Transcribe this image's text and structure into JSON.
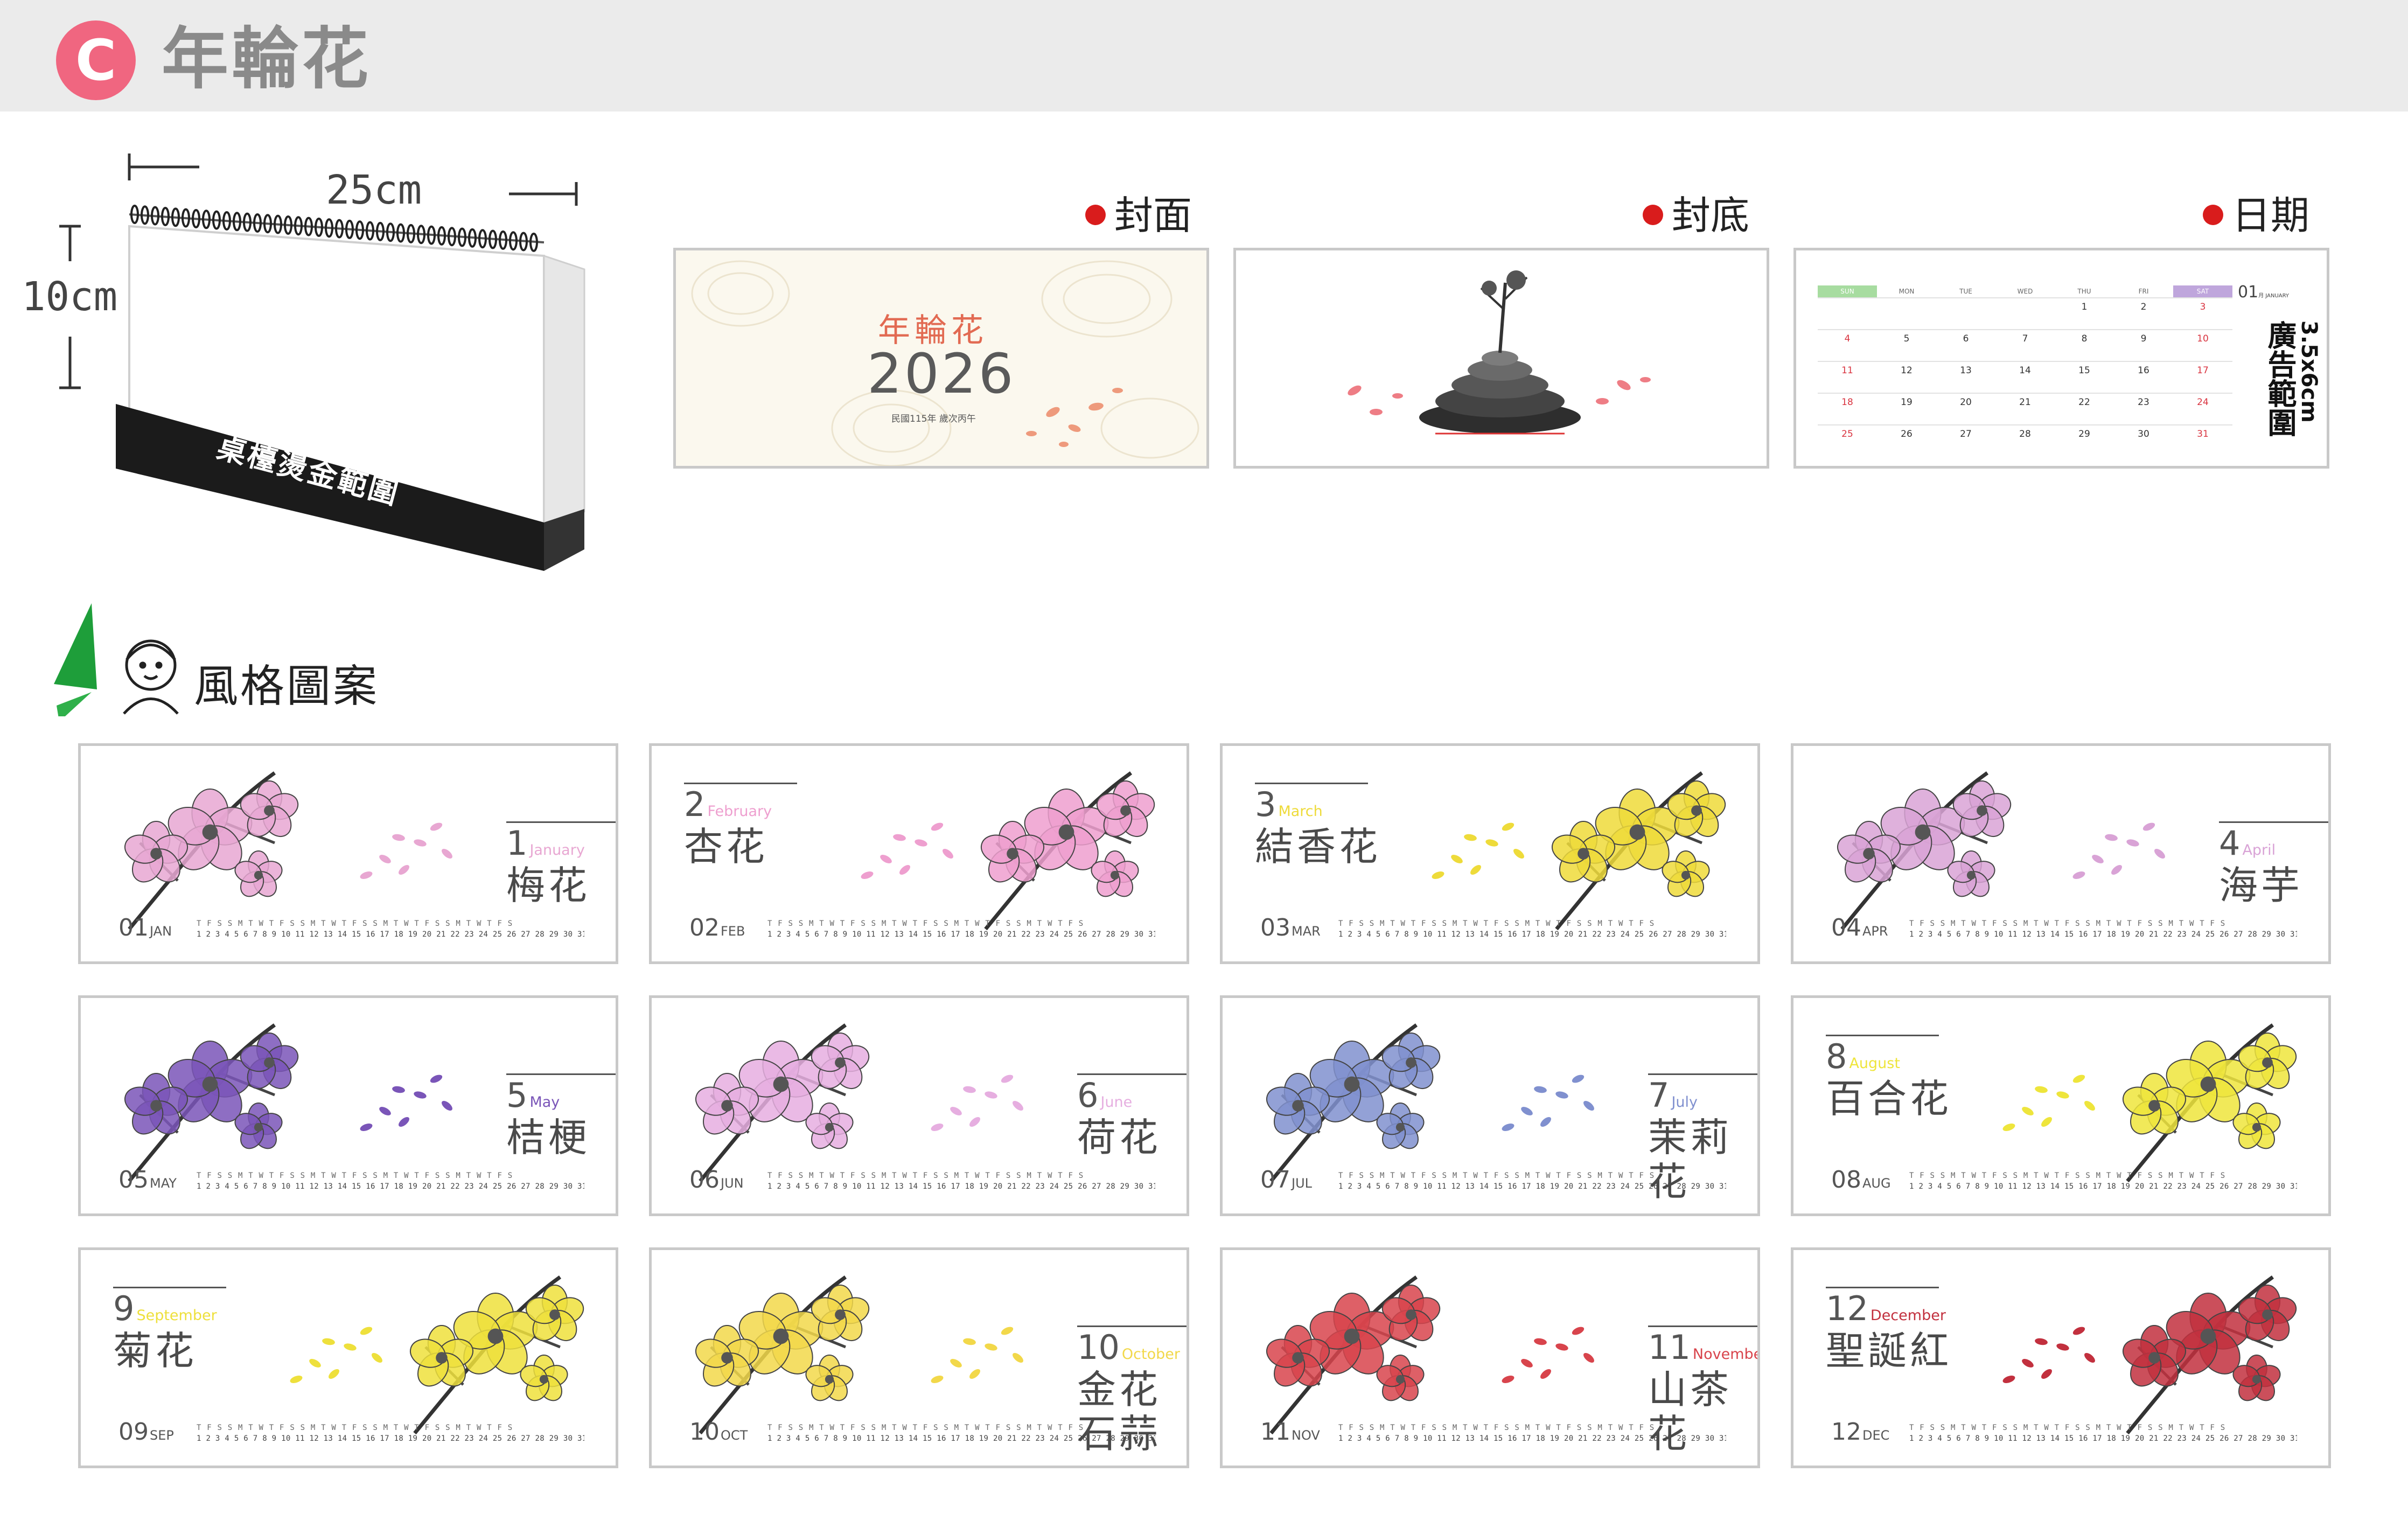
{
  "header": {
    "badge_letter": "C",
    "title": "年輪花",
    "background_color": "#ebebeb",
    "badge_color": "#f06680"
  },
  "desk_calendar": {
    "width_label": "25cm",
    "height_label": "10cm",
    "base_text": "桌檯燙金範圍"
  },
  "previews": {
    "cover_label": "封面",
    "back_label": "封底",
    "dates_label": "日期",
    "cover": {
      "title": "年輪花",
      "year": "2026",
      "subtitle": "民國115年 歲次丙午"
    },
    "dates": {
      "day_headers": [
        "SUN",
        "MON",
        "TUE",
        "WED",
        "THU",
        "FRI",
        "SAT"
      ],
      "weeks": [
        [
          "",
          "",
          "",
          "",
          "1",
          "2",
          "3"
        ],
        [
          "4",
          "5",
          "6",
          "7",
          "8",
          "9",
          "10"
        ],
        [
          "11",
          "12",
          "13",
          "14",
          "15",
          "16",
          "17"
        ],
        [
          "18",
          "19",
          "20",
          "21",
          "22",
          "23",
          "24"
        ],
        [
          "25",
          "26",
          "27",
          "28",
          "29",
          "30",
          "31"
        ]
      ],
      "month_label": "01",
      "month_suffix": "月 JANUARY",
      "ad_area_text": "廣告範圍",
      "ad_size": "3.5x6cm"
    }
  },
  "style_section": {
    "title": "風格圖案"
  },
  "months": [
    {
      "num": "1",
      "eng": "January",
      "name": "梅花",
      "foot_num": "01",
      "foot_abbr": "JAN",
      "color": "#e8a7d2"
    },
    {
      "num": "2",
      "eng": "February",
      "name": "杏花",
      "foot_num": "02",
      "foot_abbr": "FEB",
      "color": "#ee9fcf"
    },
    {
      "num": "3",
      "eng": "March",
      "name": "結香花",
      "foot_num": "03",
      "foot_abbr": "MAR",
      "color": "#eedb3a"
    },
    {
      "num": "4",
      "eng": "April",
      "name": "海芋",
      "foot_num": "04",
      "foot_abbr": "APR",
      "color": "#d9a3d6"
    },
    {
      "num": "5",
      "eng": "May",
      "name": "桔梗",
      "foot_num": "05",
      "foot_abbr": "MAY",
      "color": "#7a55b8"
    },
    {
      "num": "6",
      "eng": "June",
      "name": "荷花",
      "foot_num": "06",
      "foot_abbr": "JUN",
      "color": "#e6aee0"
    },
    {
      "num": "7",
      "eng": "July",
      "name": "茉莉花",
      "foot_num": "07",
      "foot_abbr": "JUL",
      "color": "#8090cf"
    },
    {
      "num": "8",
      "eng": "August",
      "name": "百合花",
      "foot_num": "08",
      "foot_abbr": "AUG",
      "color": "#eee53c"
    },
    {
      "num": "9",
      "eng": "September",
      "name": "菊花",
      "foot_num": "09",
      "foot_abbr": "SEP",
      "color": "#eee03c"
    },
    {
      "num": "10",
      "eng": "October",
      "name": "金花石蒜",
      "foot_num": "10",
      "foot_abbr": "OCT",
      "color": "#f2d84a"
    },
    {
      "num": "11",
      "eng": "November",
      "name": "山茶花",
      "foot_num": "11",
      "foot_abbr": "NOV",
      "color": "#d8444c"
    },
    {
      "num": "12",
      "eng": "December",
      "name": "聖誕紅",
      "foot_num": "12",
      "foot_abbr": "DEC",
      "color": "#c2303e"
    }
  ],
  "day_strip": {
    "weekday_row": "T F S S M T W T F S S M T W T F S S M T W T F S S M T W T F S",
    "date_row": "1 2 3 4 5 6 7 8 9 10 11 12 13 14 15 16 17 18 19 20 21 22 23 24 25 26 27 28 29 30 31"
  }
}
